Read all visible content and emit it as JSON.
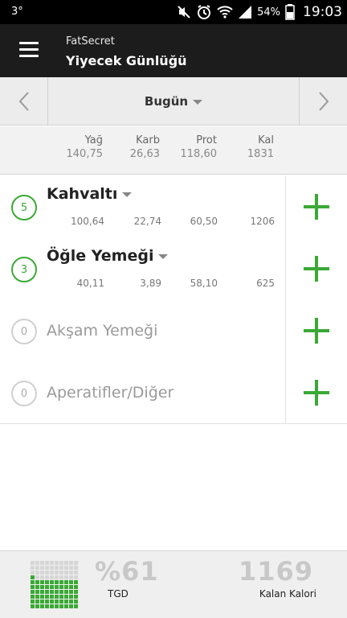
{
  "statusbar": {
    "temperature": "3°",
    "battery_pct": "54%",
    "time": "19:03",
    "icons": [
      "mute-icon",
      "alarm-icon",
      "wifi-icon",
      "signal-icon",
      "battery-icon"
    ]
  },
  "appbar": {
    "app_name": "FatSecret",
    "title": "Yiyecek Günlüğü",
    "menu_icon": "hamburger-menu-icon"
  },
  "datenav": {
    "date_label": "Bugün",
    "prev_icon": "chevron-left-icon",
    "next_icon": "chevron-right-icon"
  },
  "totals": {
    "fat_label": "Yağ",
    "fat_value": "140,75",
    "carb_label": "Karb",
    "carb_value": "26,63",
    "prot_label": "Prot",
    "prot_value": "118,60",
    "cal_label": "Kal",
    "cal_value": "1831"
  },
  "meals": [
    {
      "count": "5",
      "name": "Kahvaltı",
      "fat": "100,64",
      "carb": "22,74",
      "prot": "60,50",
      "cal": "1206"
    },
    {
      "count": "3",
      "name": "Öğle Yemeği",
      "fat": "40,11",
      "carb": "3,89",
      "prot": "58,10",
      "cal": "625"
    },
    {
      "count": "0",
      "name": "Akşam Yemeği"
    },
    {
      "count": "0",
      "name": "Aperatifler/Diğer"
    }
  ],
  "footer": {
    "rdi_value": "%61",
    "rdi_label": "TGD",
    "rdi_fraction": 0.61,
    "remaining_value": "1169",
    "remaining_label": "Kalan Kalori"
  },
  "colors": {
    "accent_green": "#3aa935",
    "appbar_bg": "#1c1c1c",
    "muted_gray": "#c8c8c8"
  }
}
